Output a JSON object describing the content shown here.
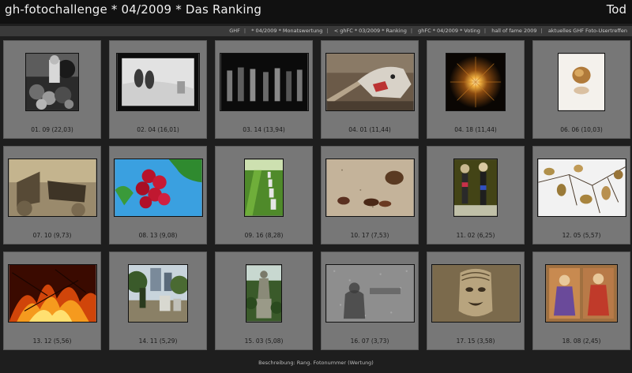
{
  "header": {
    "title": "gh-fotochallenge * 04/2009 * Das Ranking",
    "subject": "Tod"
  },
  "nav": {
    "links": [
      "GHF",
      "* 04/2009 * Monatswertung",
      "< ghFC * 03/2009 * Ranking",
      "ghFC * 04/2009 * Voting",
      "hall of fame 2009",
      "aktuelles GHF Foto-Usertreffen"
    ]
  },
  "photos": [
    {
      "caption": "01. 09 (22,03)",
      "icon": "photo-person-flowers"
    },
    {
      "caption": "02. 04 (16,01)",
      "icon": "photo-feet"
    },
    {
      "caption": "03. 14 (13,94)",
      "icon": "photo-graves"
    },
    {
      "caption": "04. 01 (11,44)",
      "icon": "photo-wolf"
    },
    {
      "caption": "04. 18 (11,44)",
      "icon": "photo-candle"
    },
    {
      "caption": "06. 06 (10,03)",
      "icon": "photo-dried-rose"
    },
    {
      "caption": "07. 10 (9,73)",
      "icon": "photo-cemetery-sepia"
    },
    {
      "caption": "08. 13 (9,08)",
      "icon": "photo-berries"
    },
    {
      "caption": "09. 16 (8,28)",
      "icon": "photo-crosses-lawn"
    },
    {
      "caption": "10. 17 (7,53)",
      "icon": "photo-dead-bird"
    },
    {
      "caption": "11. 02 (6,25)",
      "icon": "photo-skeleton-figures"
    },
    {
      "caption": "12. 05 (5,57)",
      "icon": "photo-dry-leaves"
    },
    {
      "caption": "13. 12 (5,56)",
      "icon": "photo-fire"
    },
    {
      "caption": "14. 11 (5,29)",
      "icon": "photo-city-cemetery"
    },
    {
      "caption": "15. 03 (5,08)",
      "icon": "photo-statue"
    },
    {
      "caption": "16. 07 (3,73)",
      "icon": "photo-stone-text"
    },
    {
      "caption": "17. 15 (3,58)",
      "icon": "photo-stone-face"
    },
    {
      "caption": "18. 08 (2,45)",
      "icon": "photo-fresco"
    }
  ],
  "footer": {
    "text": "Beschreibung: Rang. Fotonummer (Wertung)"
  }
}
